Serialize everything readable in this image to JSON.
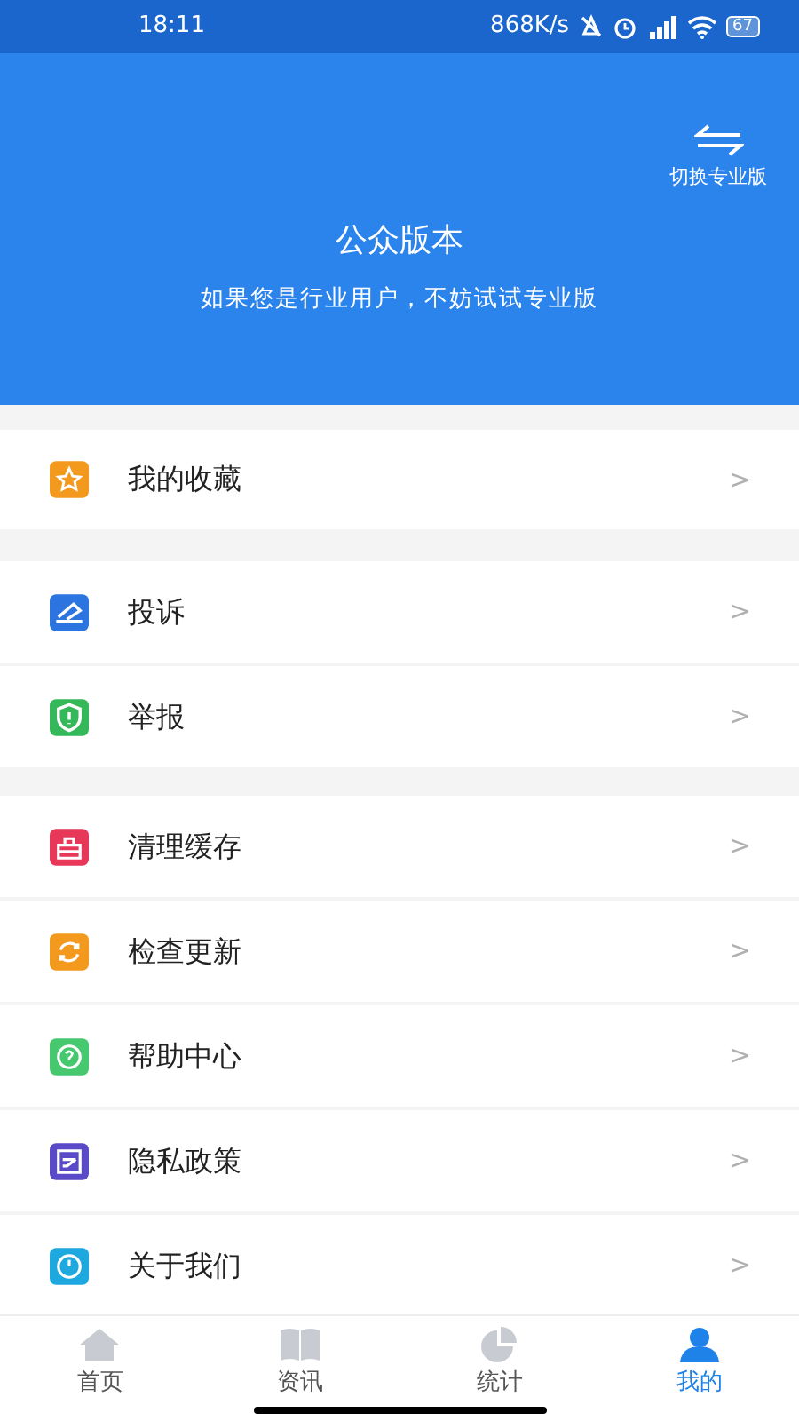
{
  "status_bar": {
    "time": "18:11",
    "speed": "868K/s",
    "battery": "67"
  },
  "header": {
    "switch_label": "切换专业版",
    "title": "公众版本",
    "subtitle": "如果您是行业用户，不妨试试专业版"
  },
  "sections": [
    {
      "items": [
        {
          "label": "我的收藏",
          "color": "#f39a1e",
          "chevron": ">"
        }
      ]
    },
    {
      "items": [
        {
          "label": "投诉",
          "color": "#2c74e0",
          "chevron": ">"
        },
        {
          "label": "举报",
          "color": "#35b85a",
          "chevron": ">"
        }
      ]
    },
    {
      "items": [
        {
          "label": "清理缓存",
          "color": "#e8385a",
          "chevron": ">"
        },
        {
          "label": "检查更新",
          "color": "#f39a1e",
          "chevron": ">"
        },
        {
          "label": "帮助中心",
          "color": "#45c86e",
          "chevron": ">"
        },
        {
          "label": "隐私政策",
          "color": "#5a4ac8",
          "chevron": ">"
        },
        {
          "label": "关于我们",
          "color": "#1ea8e0",
          "chevron": ">"
        }
      ]
    }
  ],
  "tabs": [
    {
      "label": "首页",
      "selected": false
    },
    {
      "label": "资讯",
      "selected": false
    },
    {
      "label": "统计",
      "selected": false
    },
    {
      "label": "我的",
      "selected": true
    }
  ]
}
